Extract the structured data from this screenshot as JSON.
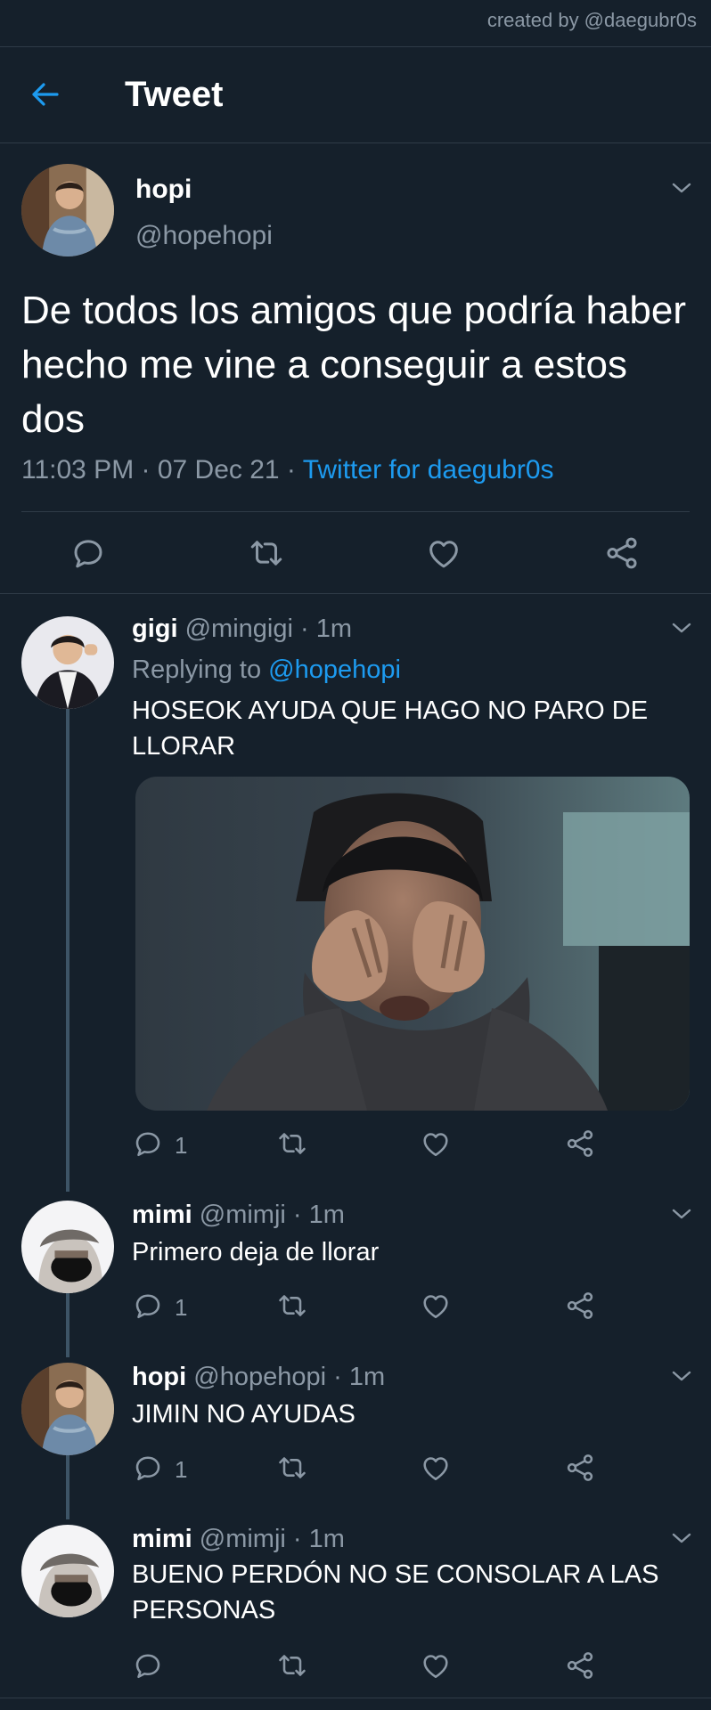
{
  "credit": "created by @daegubr0s",
  "header": {
    "title": "Tweet"
  },
  "main_tweet": {
    "name": "hopi",
    "handle": "@hopehopi",
    "text": "De todos los amigos que podría haber hecho me vine a conseguir a estos dos",
    "time": "11:03 PM · 07 Dec 21 · ",
    "source": "Twitter for daegubr0s"
  },
  "replies": [
    {
      "name": "gigi",
      "handle": "@mingigi · 1m",
      "replying_prefix": "Replying to ",
      "replying_to": "@hopehopi",
      "text": "HOSEOK AYUDA QUE HAGO NO PARO DE LLORAR",
      "reply_count": "1"
    },
    {
      "name": "mimi",
      "handle": "@mimji · 1m",
      "text": "Primero deja de llorar",
      "reply_count": "1"
    },
    {
      "name": "hopi",
      "handle": "@hopehopi · 1m",
      "text": "JIMIN NO AYUDAS",
      "reply_count": "1"
    },
    {
      "name": "mimi",
      "handle": "@mimji · 1m",
      "text": "BUENO PERDÓN NO SE CONSOLAR A LAS PERSONAS",
      "reply_count": ""
    }
  ],
  "icons": [
    "back-arrow-icon",
    "chevron-down-icon",
    "reply-icon",
    "retweet-icon",
    "like-icon",
    "share-icon"
  ],
  "colors": {
    "background": "#15202b",
    "accent": "#1d9bf0",
    "muted": "#8b98a5",
    "divider": "#2f3b47"
  }
}
